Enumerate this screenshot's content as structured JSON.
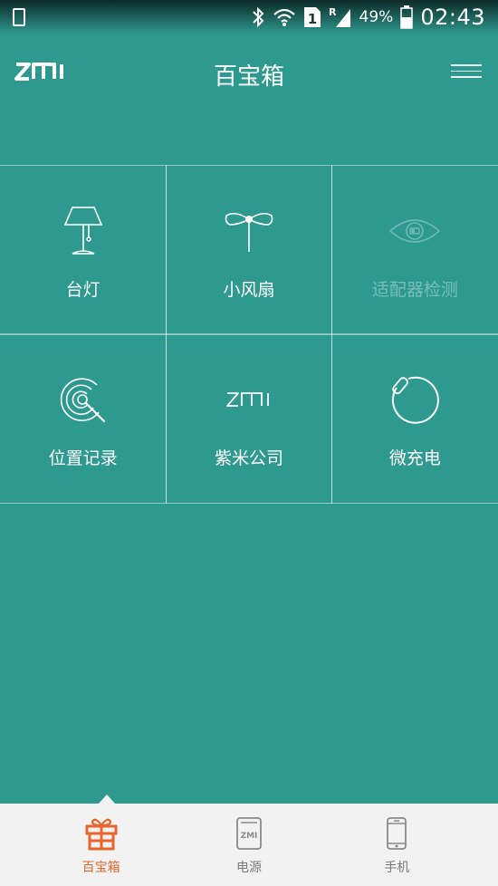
{
  "status_bar": {
    "battery": "49%",
    "time": "02:43",
    "icons": [
      "sim-card-icon",
      "bluetooth-icon",
      "wifi-icon",
      "sim1-icon",
      "signal-icon",
      "battery-icon"
    ]
  },
  "header": {
    "logo": "ZMI",
    "title": "百宝箱",
    "menu_icon": "menu-icon"
  },
  "grid": {
    "items": [
      {
        "label": "台灯",
        "icon": "desk-lamp-icon",
        "enabled": true
      },
      {
        "label": "小风扇",
        "icon": "fan-icon",
        "enabled": true
      },
      {
        "label": "适配器检测",
        "icon": "eye-icon",
        "enabled": false
      },
      {
        "label": "位置记录",
        "icon": "location-radar-icon",
        "enabled": true
      },
      {
        "label": "紫米公司",
        "icon": "zmi-logo-icon",
        "enabled": true
      },
      {
        "label": "微充电",
        "icon": "power-ring-icon",
        "enabled": true
      }
    ]
  },
  "bottom_nav": {
    "items": [
      {
        "label": "百宝箱",
        "icon": "gift-box-icon",
        "active": true
      },
      {
        "label": "电源",
        "icon": "power-bank-icon",
        "active": false
      },
      {
        "label": "手机",
        "icon": "phone-icon",
        "active": false
      }
    ]
  },
  "colors": {
    "background": "#2e9a8f",
    "accent": "#e8662e",
    "nav_bg": "#f2f2f2"
  }
}
